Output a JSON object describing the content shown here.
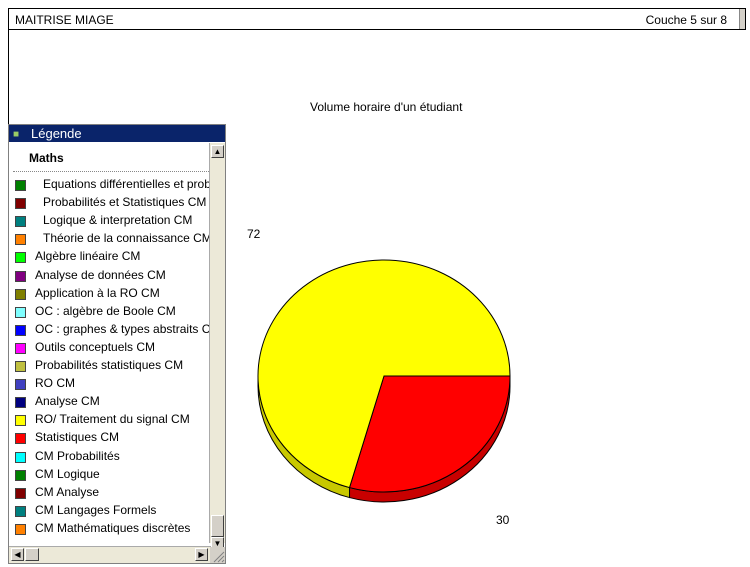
{
  "header": {
    "title": "MAITRISE MIAGE",
    "layer_status": "Couche 5 sur 8"
  },
  "legend": {
    "title": "Légende",
    "group": "Maths",
    "items": [
      {
        "label": "Equations différentielles et probl",
        "color": "#008000",
        "indent": true
      },
      {
        "label": "Probabilités et Statistiques CM",
        "color": "#800000",
        "indent": true
      },
      {
        "label": "Logique & interpretation CM",
        "color": "#008080",
        "indent": true
      },
      {
        "label": "Théorie de la connaissance CM",
        "color": "#ff8000",
        "indent": true
      },
      {
        "label": "Algèbre linéaire CM",
        "color": "#00ff00",
        "indent": false
      },
      {
        "label": "Analyse de données CM",
        "color": "#800080",
        "indent": false
      },
      {
        "label": "Application à la RO CM",
        "color": "#808000",
        "indent": false
      },
      {
        "label": "OC : algèbre de Boole CM",
        "color": "#80ffff",
        "indent": false
      },
      {
        "label": "OC : graphes & types abstraits CM",
        "color": "#0000ff",
        "indent": false
      },
      {
        "label": "Outils conceptuels CM",
        "color": "#ff00ff",
        "indent": false
      },
      {
        "label": "Probabilités statistiques CM",
        "color": "#c0c040",
        "indent": false
      },
      {
        "label": "RO CM",
        "color": "#4040c0",
        "indent": false
      },
      {
        "label": "Analyse CM",
        "color": "#000080",
        "indent": false
      },
      {
        "label": "RO/ Traitement du signal CM",
        "color": "#ffff00",
        "indent": false
      },
      {
        "label": "Statistiques CM",
        "color": "#ff0000",
        "indent": false
      },
      {
        "label": "CM Probabilités",
        "color": "#00ffff",
        "indent": false
      },
      {
        "label": "CM Logique",
        "color": "#008000",
        "indent": false
      },
      {
        "label": "CM Analyse",
        "color": "#800000",
        "indent": false
      },
      {
        "label": "CM Langages Formels",
        "color": "#008080",
        "indent": false
      },
      {
        "label": "CM Mathématiques discrètes",
        "color": "#ff8000",
        "indent": false
      }
    ]
  },
  "chart_data": {
    "type": "pie",
    "title": "Volume horaire d'un étudiant",
    "values": [
      72,
      30
    ],
    "value_labels": [
      "72",
      "30"
    ],
    "colors": [
      "#ffff00",
      "#ff0000"
    ],
    "side_colors": [
      "#c8c800",
      "#c80000"
    ]
  }
}
